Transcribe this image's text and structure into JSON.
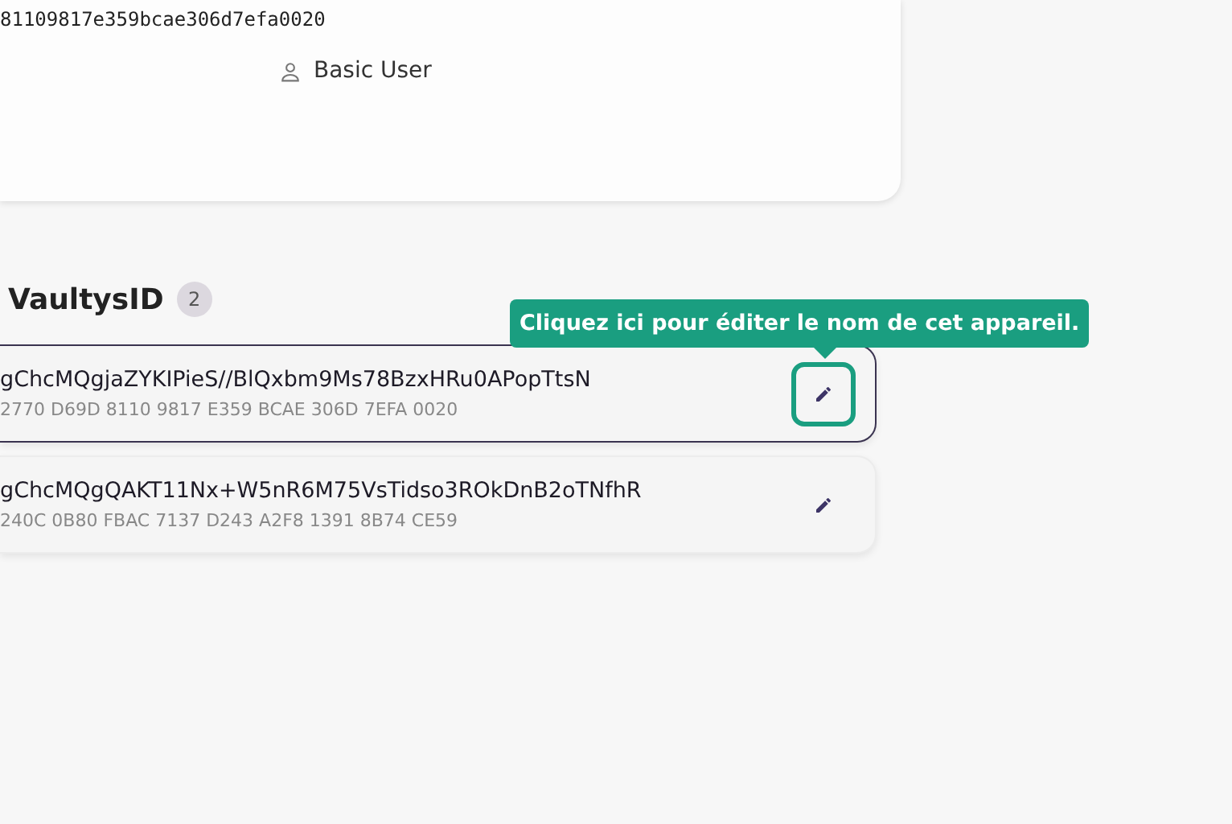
{
  "profile": {
    "key": "81109817e359bcae306d7efa0020",
    "role": "Basic User"
  },
  "section": {
    "title": "VaultysID",
    "count": "2"
  },
  "devices": [
    {
      "name": "gChcMQgjaZYKIPieS//BlQxbm9Ms78BzxHRu0APopTtsN",
      "fingerprint": "2770 D69D 8110 9817 E359 BCAE 306D 7EFA 0020",
      "selected": true
    },
    {
      "name": "gChcMQgQAKT11Nx+W5nR6M75VsTidso3ROkDnB2oTNfhR",
      "fingerprint": "240C 0B80 FBAC 7137 D243 A2F8 1391 8B74 CE59",
      "selected": false
    }
  ],
  "tooltip": {
    "text": "Cliquez ici pour éditer le nom de cet appareil."
  }
}
